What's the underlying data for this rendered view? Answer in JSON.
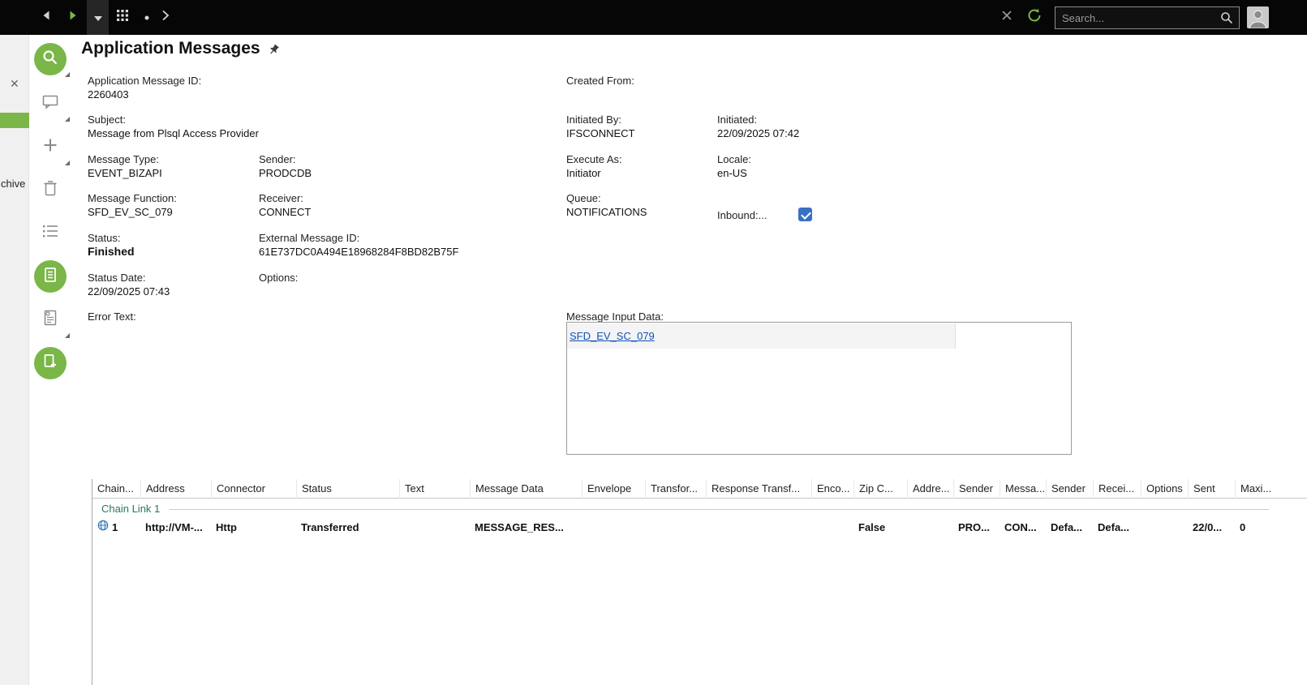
{
  "colors": {
    "accent_green": "#7ab648",
    "topbar_black": "#060606",
    "checkbox_blue": "#3a6fc4",
    "link_blue": "#0f52bb",
    "group_row_teal": "#2a7563"
  },
  "topbar": {
    "search_placeholder": "Search..."
  },
  "side_panel": {
    "partial_label": "chive",
    "close_glyph": "✕"
  },
  "page": {
    "title": "Application Messages"
  },
  "fields": {
    "application_message_id": {
      "label": "Application Message ID:",
      "value": "2260403"
    },
    "created_from": {
      "label": "Created From:",
      "value": ""
    },
    "subject": {
      "label": "Subject:",
      "value": "Message from Plsql Access Provider"
    },
    "initiated_by": {
      "label": "Initiated By:",
      "value": "IFSCONNECT"
    },
    "initiated": {
      "label": "Initiated:",
      "value": "22/09/2025 07:42"
    },
    "message_type": {
      "label": "Message Type:",
      "value": "EVENT_BIZAPI"
    },
    "sender": {
      "label": "Sender:",
      "value": "PRODCDB"
    },
    "execute_as": {
      "label": "Execute As:",
      "value": "Initiator"
    },
    "locale": {
      "label": "Locale:",
      "value": "en-US"
    },
    "message_function": {
      "label": "Message Function:",
      "value": "SFD_EV_SC_079"
    },
    "receiver": {
      "label": "Receiver:",
      "value": "CONNECT"
    },
    "queue": {
      "label": "Queue:",
      "value": "NOTIFICATIONS"
    },
    "inbound": {
      "label": "Inbound:...",
      "checked": true
    },
    "status": {
      "label": "Status:",
      "value": "Finished"
    },
    "external_message_id": {
      "label": "External Message ID:",
      "value": "61E737DC0A494E18968284F8BD82B75F"
    },
    "status_date": {
      "label": "Status Date:",
      "value": "22/09/2025 07:43"
    },
    "options": {
      "label": "Options:",
      "value": ""
    },
    "error_text": {
      "label": "Error Text:",
      "value": ""
    },
    "message_input_data": {
      "label": "Message Input Data:",
      "link_text": "SFD_EV_SC_079"
    }
  },
  "table": {
    "columns": [
      "Chain...",
      "Address",
      "Connector",
      "Status",
      "Text",
      "Message Data",
      "Envelope",
      "Transfor...",
      "Response Transf...",
      "Enco...",
      "Zip C...",
      "Addre...",
      "Sender",
      "Messa...",
      "Sender",
      "Recei...",
      "Options",
      "Sent",
      "Maxi..."
    ],
    "group_label": "Chain Link 1",
    "row": [
      "1",
      "http://VM-...",
      "Http",
      "Transferred",
      "",
      "MESSAGE_RES...",
      "",
      "",
      "",
      "",
      "False",
      "",
      "PRO...",
      "CON...",
      "Defa...",
      "Defa...",
      "",
      "22/0...",
      "0"
    ]
  }
}
